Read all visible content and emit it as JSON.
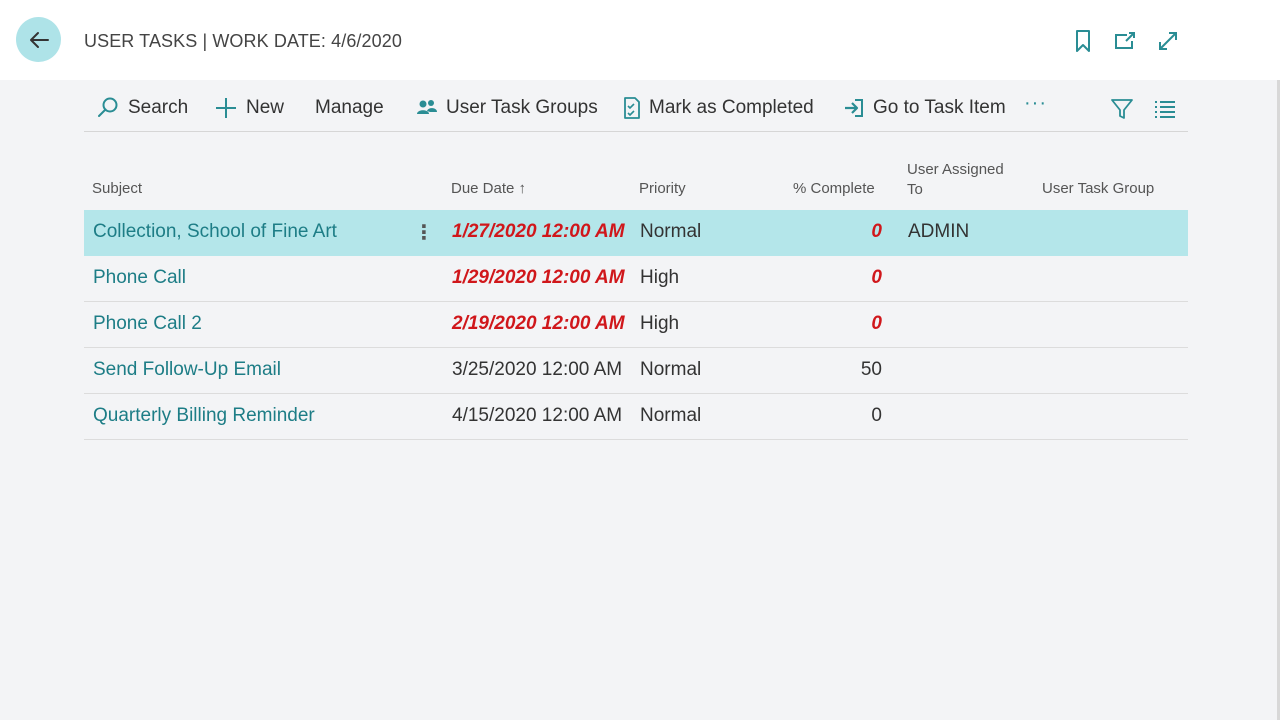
{
  "header": {
    "title": "USER TASKS | WORK DATE: 4/6/2020",
    "icons": [
      "back-arrow-icon",
      "bookmark-icon",
      "open-new-window-icon",
      "expand-icon"
    ]
  },
  "actions": {
    "search": "Search",
    "new": "New",
    "manage": "Manage",
    "user_task_groups": "User Task Groups",
    "mark_completed": "Mark as Completed",
    "go_to_task": "Go to Task Item",
    "more": "···"
  },
  "columns": {
    "subject": "Subject",
    "due_date": "Due Date",
    "due_sort": "↑",
    "priority": "Priority",
    "pct_complete": "% Complete",
    "user_assigned_line1": "User Assigned",
    "user_assigned_line2": "To",
    "group": "User Task Group"
  },
  "rows": [
    {
      "subject": "Collection, School of Fine Art",
      "due": "1/27/2020 12:00 AM",
      "priority": "Normal",
      "pct": "0",
      "user": "ADMIN",
      "group": "",
      "overdue": true,
      "selected": true,
      "menu": "⋮"
    },
    {
      "subject": "Phone Call",
      "due": "1/29/2020 12:00 AM",
      "priority": "High",
      "pct": "0",
      "user": "",
      "group": "",
      "overdue": true
    },
    {
      "subject": "Phone Call 2",
      "due": "2/19/2020 12:00 AM",
      "priority": "High",
      "pct": "0",
      "user": "",
      "group": "",
      "overdue": true
    },
    {
      "subject": "Send Follow-Up Email",
      "due": "3/25/2020 12:00 AM",
      "priority": "Normal",
      "pct": "50",
      "user": "",
      "group": "",
      "overdue": false
    },
    {
      "subject": "Quarterly Billing Reminder",
      "due": "4/15/2020 12:00 AM",
      "priority": "Normal",
      "pct": "0",
      "user": "",
      "group": "",
      "overdue": false
    }
  ],
  "colors": {
    "accent": "#1d7d86",
    "selected_row": "#b4e6ea",
    "overdue": "#d0171b"
  }
}
